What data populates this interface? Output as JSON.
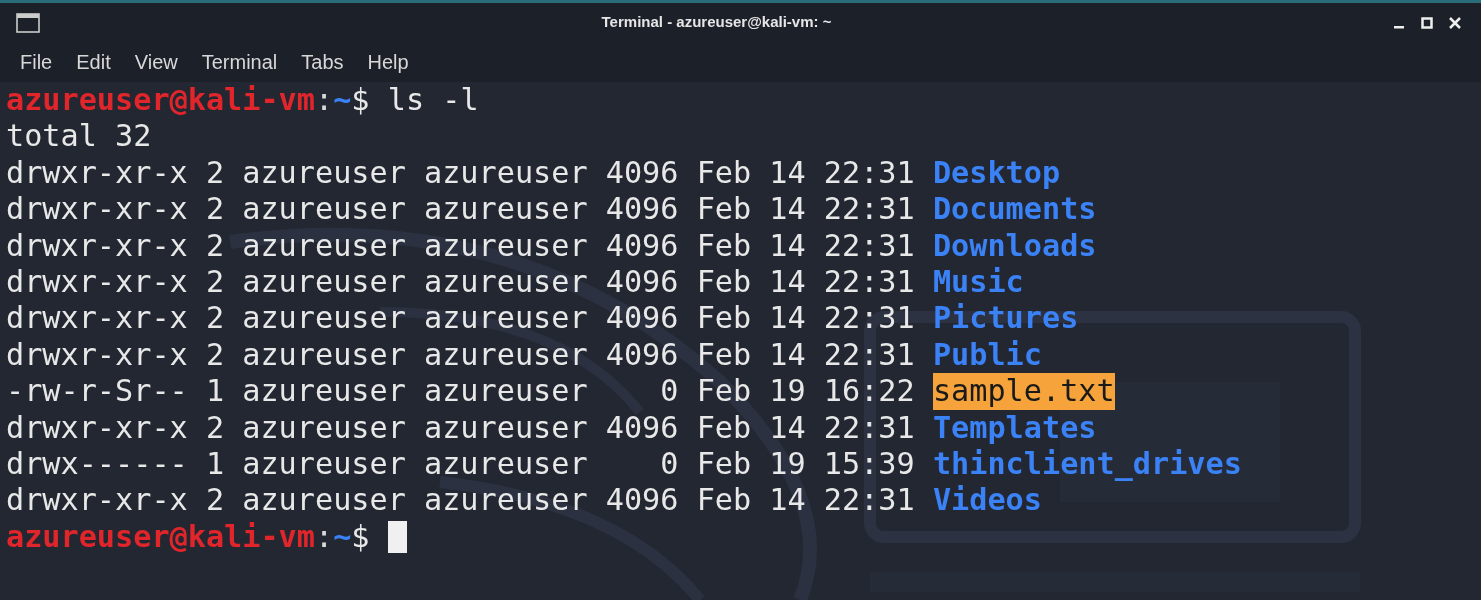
{
  "window": {
    "title": "Terminal - azureuser@kali-vm: ~"
  },
  "menu": [
    "File",
    "Edit",
    "View",
    "Terminal",
    "Tabs",
    "Help"
  ],
  "lines": [
    {
      "kind": "prompt",
      "user_host": "azureuser@kali-vm",
      "separator": ":",
      "path": "~",
      "symbol": "$",
      "command": "ls -l",
      "cursor": false
    },
    {
      "kind": "text",
      "text": "total 32"
    },
    {
      "kind": "directory",
      "info": "drwxr-xr-x 2 azureuser azureuser 4096 Feb 14 22:31",
      "name": "Desktop"
    },
    {
      "kind": "directory",
      "info": "drwxr-xr-x 2 azureuser azureuser 4096 Feb 14 22:31",
      "name": "Documents"
    },
    {
      "kind": "directory",
      "info": "drwxr-xr-x 2 azureuser azureuser 4096 Feb 14 22:31",
      "name": "Downloads"
    },
    {
      "kind": "directory",
      "info": "drwxr-xr-x 2 azureuser azureuser 4096 Feb 14 22:31",
      "name": "Music"
    },
    {
      "kind": "directory",
      "info": "drwxr-xr-x 2 azureuser azureuser 4096 Feb 14 22:31",
      "name": "Pictures"
    },
    {
      "kind": "directory",
      "info": "drwxr-xr-x 2 azureuser azureuser 4096 Feb 14 22:31",
      "name": "Public"
    },
    {
      "kind": "setuid_file",
      "info": "-rw-r-Sr-- 1 azureuser azureuser    0 Feb 19 16:22",
      "name": "sample.txt"
    },
    {
      "kind": "directory",
      "info": "drwxr-xr-x 2 azureuser azureuser 4096 Feb 14 22:31",
      "name": "Templates"
    },
    {
      "kind": "directory",
      "info": "drwx------ 1 azureuser azureuser    0 Feb 19 15:39",
      "name": "thinclient_drives"
    },
    {
      "kind": "directory",
      "info": "drwxr-xr-x 2 azureuser azureuser 4096 Feb 14 22:31",
      "name": "Videos"
    },
    {
      "kind": "prompt",
      "user_host": "azureuser@kali-vm",
      "separator": ":",
      "path": "~",
      "symbol": "$",
      "cursor": true
    }
  ]
}
